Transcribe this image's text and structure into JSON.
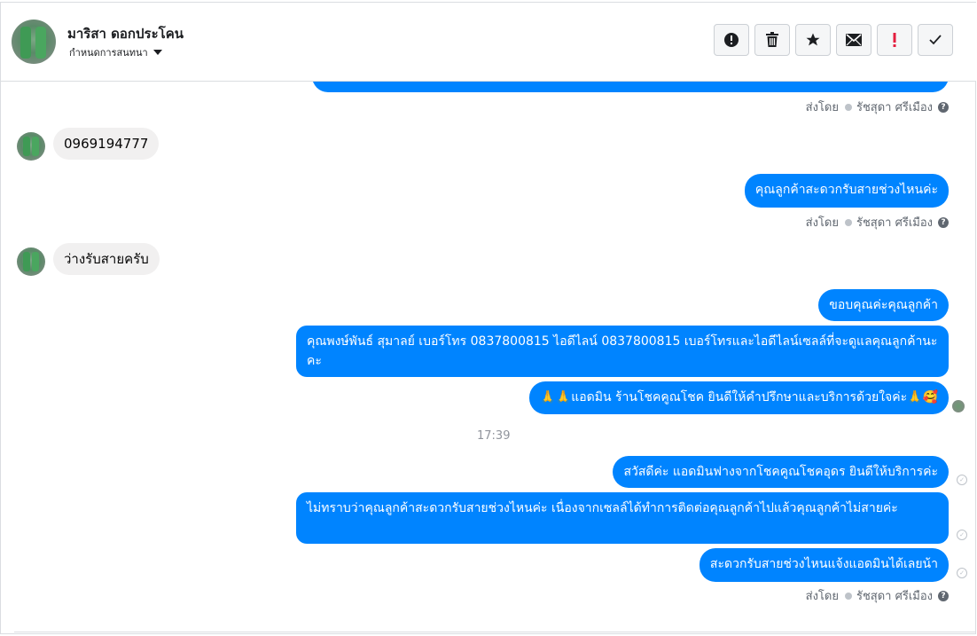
{
  "header": {
    "contact_name": "มาริสา ดอกประโคน",
    "assign_label": "กำหนดการสนทนา",
    "actions": [
      {
        "name": "alert-icon",
        "glyph": "!"
      },
      {
        "name": "trash-icon",
        "glyph": "🗑"
      },
      {
        "name": "star-icon",
        "glyph": "★"
      },
      {
        "name": "mail-icon",
        "glyph": "✉"
      },
      {
        "name": "exclamation-icon",
        "glyph": "!"
      },
      {
        "name": "check-icon",
        "glyph": "✓"
      }
    ]
  },
  "thread": {
    "sent_by_label": "ส่งโดย",
    "sender_name": "รัชสุดา ศรีเมือง",
    "help_glyph": "?",
    "incoming": [
      {
        "text": "0969194777"
      },
      {
        "text": "ว่างรับสายครับ"
      }
    ],
    "outgoing": [
      {
        "text": "คุณลูกค้าสะดวกรับสายช่วงไหนค่ะ"
      },
      {
        "text": "ขอบคุณค่ะคุณลูกค้า"
      },
      {
        "text": "คุณพงษ์พันธ์ สุมาลย์      เบอร์โทร 0837800815  ไอดีไลน์ 0837800815   เบอร์โทรและไอดีไลน์เซลล์ที่จะดูแลคุณลูกค้านะคะ"
      },
      {
        "text": "🙏🙏แอดมิน ร้านโชคคูณโชค ยินดีให้คำปรึกษาและบริการด้วยใจค่ะ🙏🥰"
      },
      {
        "text": "สวัสดีค่ะ แอดมินฟางจากโชคคูณโชคอุดร ยินดีให้บริการค่ะ"
      },
      {
        "text": "ไม่ทราบว่าคุณลูกค้าสะดวกรับสายช่วงไหนค่ะ  เนื่องจากเซลล์ได้ทำการติดต่อคุณลูกค้าไปแล้วคุณลูกค้าไม่สายค่ะ"
      },
      {
        "text": "สะดวกรับสายช่วงไหนแจ้งแอดมินได้เลยน้า"
      }
    ],
    "timestamp": "17:39"
  },
  "colors": {
    "outgoing_bubble": "#0084ff",
    "incoming_bubble": "#f1f0f0",
    "border": "#dadde1",
    "meta_text": "#606770"
  }
}
